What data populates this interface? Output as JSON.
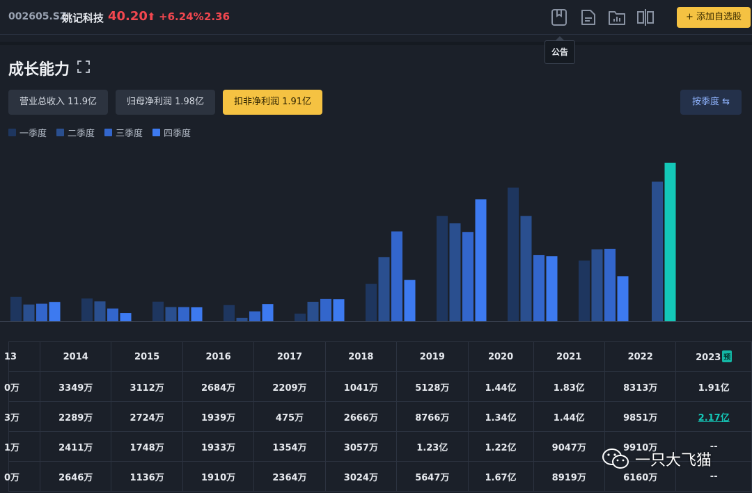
{
  "header": {
    "code": "002605.SZ",
    "name": "姚记科技",
    "price": "40.20",
    "arrow": "⬆",
    "change_pct": "+6.24%",
    "change": "2.36",
    "add_button": "+ 添加自选股",
    "tooltip": "公告",
    "icons": [
      "bookmark-icon",
      "document-icon",
      "folder-chart-icon",
      "compare-icon"
    ]
  },
  "section": {
    "title": "成长能力",
    "tabs": [
      {
        "label": "营业总收入 11.9亿",
        "active": false
      },
      {
        "label": "归母净利润 1.98亿",
        "active": false
      },
      {
        "label": "扣非净利润 1.91亿",
        "active": true
      }
    ],
    "season_toggle": "按季度 ⇆"
  },
  "colors": {
    "q1": "#1e365f",
    "q2": "#2a4f8f",
    "q3": "#3366cc",
    "q4": "#3d7af0",
    "forecast": "#14c8b8",
    "accent": "#f5c242",
    "up": "#f2474f"
  },
  "chart_data": {
    "type": "bar",
    "unit": "万",
    "categories": [
      "2013",
      "2014",
      "2015",
      "2016",
      "2017",
      "2018",
      "2019",
      "2020",
      "2021",
      "2022",
      "2023"
    ],
    "series": [
      {
        "name": "一季度",
        "values": [
          null,
          3349,
          3112,
          2684,
          2209,
          1041,
          5128,
          14400,
          18300,
          8313,
          19100
        ]
      },
      {
        "name": "二季度",
        "values": [
          null,
          2289,
          2724,
          1939,
          475,
          2666,
          8766,
          13400,
          14400,
          9851,
          21700
        ]
      },
      {
        "name": "三季度",
        "values": [
          null,
          2411,
          1748,
          1933,
          1354,
          3057,
          12300,
          12200,
          9047,
          9910,
          null
        ]
      },
      {
        "name": "四季度",
        "values": [
          2580,
          2646,
          1136,
          1910,
          2364,
          3024,
          5647,
          16700,
          8919,
          6160,
          null
        ]
      }
    ],
    "forecast_flag": "预",
    "legend_placement": "top-left"
  },
  "table": {
    "header": [
      "13",
      "2014",
      "2015",
      "2016",
      "2017",
      "2018",
      "2019",
      "2020",
      "2021",
      "2022",
      "2023"
    ],
    "rows": [
      [
        "0万",
        "3349万",
        "3112万",
        "2684万",
        "2209万",
        "1041万",
        "5128万",
        "1.44亿",
        "1.83亿",
        "8313万",
        "1.91亿"
      ],
      [
        "3万",
        "2289万",
        "2724万",
        "1939万",
        "475万",
        "2666万",
        "8766万",
        "1.34亿",
        "1.44亿",
        "9851万",
        "2.17亿"
      ],
      [
        "1万",
        "2411万",
        "1748万",
        "1933万",
        "1354万",
        "3057万",
        "1.23亿",
        "1.22亿",
        "9047万",
        "9910万",
        "--"
      ],
      [
        "0万",
        "2646万",
        "1136万",
        "1910万",
        "2364万",
        "3024万",
        "5647万",
        "1.67亿",
        "8919万",
        "6160万",
        "--"
      ]
    ]
  },
  "watermark": "一只大飞猫"
}
